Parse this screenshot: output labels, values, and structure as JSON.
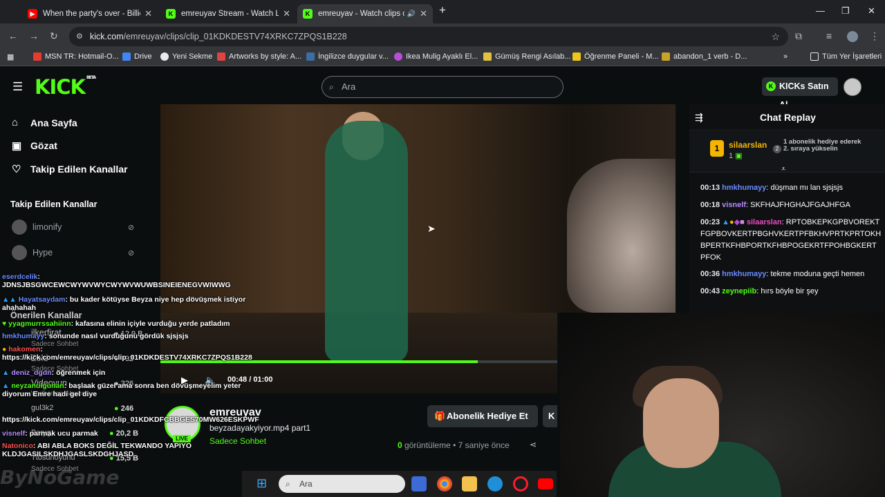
{
  "browser": {
    "tabs": [
      {
        "title": "When the party's over - Billie Ei",
        "icon": "youtube-icon",
        "color": "#ff0000"
      },
      {
        "title": "emreuyav Stream - Watch Live",
        "icon": "kick-icon",
        "color": "#53fc18"
      },
      {
        "title": "emreuyav - Watch clips on K",
        "icon": "kick-icon",
        "color": "#53fc18",
        "active": true
      }
    ],
    "url_domain": "kick.com",
    "url_path": "/emreuyav/clips/clip_01KDKDESTV74XRKC7ZPQS1B228",
    "bookmarks": [
      {
        "label": "MSN TR: Hotmail-O...",
        "color": "#e63b2e"
      },
      {
        "label": "Drive",
        "color": "#4285f4"
      },
      {
        "label": "Yeni Sekme",
        "color": "#e8eaed"
      },
      {
        "label": "Artworks by style: A...",
        "color": "#d44"
      },
      {
        "label": "İngilizce duygular v...",
        "color": "#3a6ea5"
      },
      {
        "label": "Ikea Mulig Ayaklı El...",
        "color": "#b84fd6"
      },
      {
        "label": "Gümüş Rengi Asılab...",
        "color": "#e0c040"
      },
      {
        "label": "Öğrenme Paneli - M...",
        "color": "#f0c419"
      },
      {
        "label": "abandon_1 verb - D...",
        "color": "#c9a227"
      }
    ],
    "all_bookmarks": "Tüm Yer İşaretleri"
  },
  "header": {
    "logo": "KICK",
    "logo_beta": "BETA",
    "search_placeholder": "Ara",
    "buy_kicks": "KICKs Satın Al"
  },
  "sidebar": {
    "nav": [
      {
        "label": "Ana Sayfa",
        "icon": "home-icon"
      },
      {
        "label": "Gözat",
        "icon": "browse-icon"
      },
      {
        "label": "Takip Edilen Kanallar",
        "icon": "heart-icon"
      }
    ],
    "followed_heading": "Takip Edilen Kanallar",
    "followed": [
      "limonify",
      "Hype"
    ],
    "recommended_heading": "Önerilen Kanallar",
    "recommended": [
      {
        "name": "ilkerfirat",
        "category": "Sadece Sohbet",
        "viewers": "12,9 B"
      },
      {
        "name": "Zeld",
        "category": "Sadece Sohbet",
        "viewers": "792"
      },
      {
        "name": "Videoyun",
        "category": "Wuthering Waves",
        "viewers": "326"
      },
      {
        "name": "gul3k2",
        "category": "",
        "viewers": "246"
      },
      {
        "name": "Baryg",
        "category": "",
        "viewers": "20,2 B"
      },
      {
        "name": "Ttosunoyunu",
        "category": "Sadece Sohbet",
        "viewers": "15,5 B"
      }
    ]
  },
  "player": {
    "current_time": "00:48",
    "duration": "01:00",
    "progress": 0.8
  },
  "clip": {
    "streamer": "emreuyav",
    "title": "beyzadayakyiyor.mp4 part1",
    "category": "Sadece Sohbet",
    "live_badge": "LIVE",
    "views_count": "0",
    "views_label": "görüntüleme",
    "age": "7 saniye önce",
    "gift_button": "Abonelik Hediye Et",
    "k_button": "K"
  },
  "chat": {
    "title": "Chat Replay",
    "pinned": {
      "user": "silaarslan",
      "count": "1",
      "rank": "2",
      "message": "1 abonelik hediye ederek 2. sıraya yükselin"
    },
    "messages": [
      {
        "time": "00:13",
        "user": "hmkhumayy",
        "color": "#6a8cff",
        "text": "düşman mı lan sjsjsjs"
      },
      {
        "time": "00:18",
        "user": "visnelf",
        "color": "#b48cff",
        "text": "SKFHAJFHGHAJFGAJHFGA"
      },
      {
        "time": "00:23",
        "user": "silaarslan",
        "color": "#e94bc6",
        "text": "RPTOBKEPKGPBVOREKTFGPBOVKERTPBGHVKERTPFBKHVPRTKPRTOKHBPERTKFHBPORTKFHBPOGEKRTFPOHBGKERTPFOK"
      },
      {
        "time": "00:36",
        "user": "hmkhumayy",
        "color": "#6a8cff",
        "text": "tekme moduna geçti hemen"
      },
      {
        "time": "00:43",
        "user": "zeynepiib",
        "color": "#53fc18",
        "text": "hırs böyle bir şey"
      }
    ]
  },
  "obs_overlay": [
    {
      "user": "eserdcelik",
      "color": "#6a8cff",
      "text": "JDNSJBSGWCEWCWYWVWYCWYWVWUWBSINEIENEGVWIWWG"
    },
    {
      "user": "Hayatsaydam",
      "color": "#6a8cff",
      "text": "bu kader kötüyse Beyza niye hep dövüşmek istiyor ahahahah"
    },
    {
      "user": "yyagmurrssahiinn",
      "color": "#53fc18",
      "text": "kafasına elinin içiyle vurduğu yerde patladım"
    },
    {
      "user": "hmkhumayy",
      "color": "#6a8cff",
      "text": "sonunde nasıl vurduğunu gördük sjsjsjs"
    },
    {
      "user": "hakomen",
      "color": "#ff5050",
      "text": "https://kick.com/emreuyav/clips/clip_01KDKDESTV74XRKC7ZPQS1B228"
    },
    {
      "user": "deniz_dgdn",
      "color": "#b48cff",
      "text": "öğrenmek için"
    },
    {
      "user": "neyzanulgunan",
      "color": "#53fc18",
      "text": "başlaak güzel ama sonra ben dövüşmeyelim yeter diyorum Emre hadi gel diye"
    },
    {
      "user": "",
      "color": "#fff",
      "text": "https://kick.com/emreuyav/clips/clip_01KDKDFCBBGES70MW626ESKPWF"
    },
    {
      "user": "visnelf",
      "color": "#b48cff",
      "text": "parmak ucu parmak"
    },
    {
      "user": "Natonico",
      "color": "#ff5050",
      "text": "ABI ABLA BOKS DEĞİL TEKWANDO YAPIYO KLDJGASILSKDHJGASLSKDGHJASD"
    }
  ],
  "watermark": "ByNoGame",
  "taskbar": {
    "search_placeholder": "Ara"
  }
}
